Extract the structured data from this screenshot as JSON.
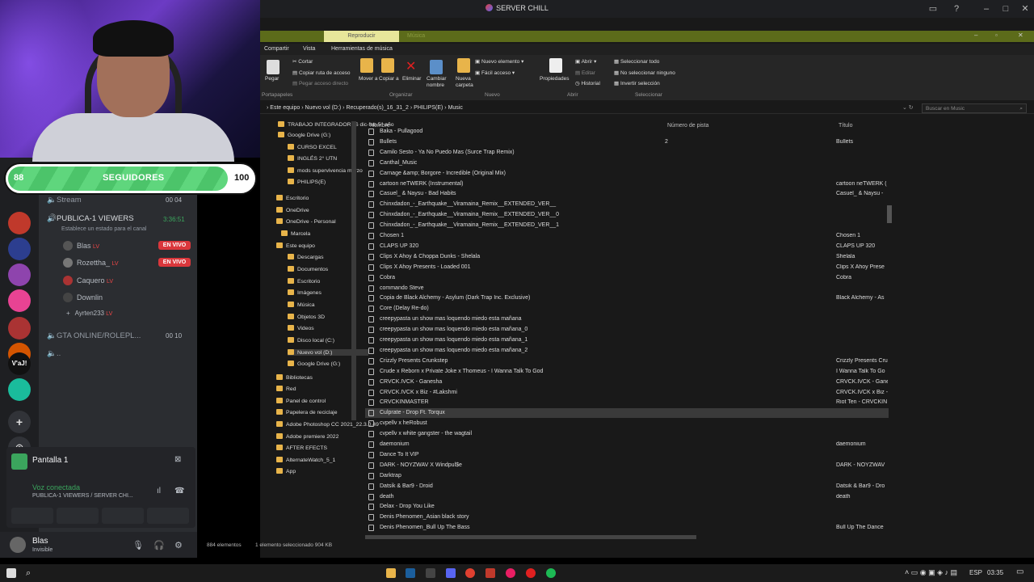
{
  "discord": {
    "window_title": "SERVER CHILL",
    "channels": [
      {
        "name": "Stream",
        "badge1": "00",
        "badge2": "04"
      },
      {
        "name": "PUBLICA-1 VIEWERS",
        "timer": "3:36:51",
        "desc": "Establece un estado para el canal"
      }
    ],
    "voice_users": [
      {
        "name": "Blas",
        "live": "EN VIVO"
      },
      {
        "name": "Rozettha_",
        "live": "EN VIVO"
      },
      {
        "name": "Caquero",
        "live": ""
      },
      {
        "name": "Downlin",
        "live": ""
      },
      {
        "name": "Ayrten233",
        "live": ""
      }
    ],
    "channel2": {
      "name": "GTA ONLINE/ROLEPL...",
      "badge1": "00",
      "badge2": "10"
    },
    "channel3": {
      "name": ".."
    },
    "lv_badge": "LV",
    "screen_share": {
      "label": "Pantalla 1"
    },
    "voice_connected": {
      "title": "Voz conectada",
      "sub": "PUBLICA-1 VIEWERS / SERVER CHI..."
    },
    "user": {
      "name": "Blas",
      "status": "Invisible"
    },
    "guild_labels": [
      "V'aJ!"
    ]
  },
  "overlay": {
    "followers_current": "88",
    "followers_label": "SEGUIDORES",
    "followers_goal": "100",
    "fill_fraction": 0.88
  },
  "explorer": {
    "ribbon_tabs": {
      "active": "Reproducir",
      "other": "Música"
    },
    "menus": [
      "Compartir",
      "Vista",
      "Herramientas de música"
    ],
    "ribbon": {
      "pegar": "Pegar",
      "cortar": "Cortar",
      "copiar_ruta": "Copiar ruta de acceso",
      "pegar_acceso": "Pegar acceso directo",
      "mover": "Mover a",
      "copiar": "Copiar a",
      "eliminar": "Eliminar",
      "cambiar": "Cambiar nombre",
      "nueva_carpeta": "Nueva carpeta",
      "nuevo_elemento": "Nuevo elemento",
      "facil_acceso": "Fácil acceso",
      "propiedades": "Propiedades",
      "abrir": "Abrir",
      "editar": "Editar",
      "historial": "Historial",
      "sel_todo": "Seleccionar todo",
      "no_sel": "No seleccionar ninguno",
      "invertir": "Invertir selección",
      "groups": [
        "Portapapeles",
        "Organizar",
        "Nuevo",
        "Abrir",
        "Seleccionar"
      ]
    },
    "breadcrumb": [
      "Este equipo",
      "Nuevo vol (D:)",
      "Recuperado(s)_16_31_2",
      "PHILIPS(E)",
      "Music"
    ],
    "search_placeholder": "Buscar en Music",
    "tree": [
      "TRABAJO INTEGRADORES dic-feb 5° año",
      "Google Drive (G:)",
      "CURSO EXCEL",
      "INGLÉS 2° UTN",
      "mods supervivencia marzo",
      "PHILIPS(E)",
      "Escritorio",
      "OneDrive",
      "OneDrive - Personal",
      "Marcela",
      "Este equipo",
      "Descargas",
      "Documentos",
      "Escritorio",
      "Imágenes",
      "Música",
      "Objetos 3D",
      "Videos",
      "Disco local (C:)",
      "Nuevo vol (D:)",
      "Google Drive (G:)",
      "Bibliotecas",
      "Red",
      "Panel de control",
      "Papelera de reciclaje",
      "Adobe Photoshop CC 2021_22.3.0.49",
      "Adobe premiere 2022",
      "AFTER EFECTS",
      "AlternateWatch_5_1",
      "App"
    ],
    "columns": {
      "name": "Nombre",
      "track": "Número de pista",
      "title": "Título"
    },
    "files": [
      {
        "name": "Baka - Pullagood",
        "track": "",
        "title": ""
      },
      {
        "name": "Bullets",
        "track": "2",
        "title": "Bullets"
      },
      {
        "name": "Camilo Sesto - Ya No Puedo Mas (Surce Trap Remix)",
        "track": "",
        "title": ""
      },
      {
        "name": "Canthal_Music",
        "track": "",
        "title": ""
      },
      {
        "name": "Carnage &amp; Borgore - Incredible (Original Mix)",
        "track": "",
        "title": ""
      },
      {
        "name": "cartoon neTWERK (Instrumental)",
        "track": "",
        "title": "cartoon neTWERK ("
      },
      {
        "name": "Casuel_ & Naysu - Bad Habits",
        "track": "",
        "title": "Casuel_ & Naysu -"
      },
      {
        "name": "Chinxdadon_-_Earthquake__Viramaina_Remix__EXTENDED_VER__",
        "track": "",
        "title": ""
      },
      {
        "name": "Chinxdadon_-_Earthquake__Viramaina_Remix__EXTENDED_VER__0",
        "track": "",
        "title": ""
      },
      {
        "name": "Chinxdadon_-_Earthquake__Viramaina_Remix__EXTENDED_VER__1",
        "track": "",
        "title": ""
      },
      {
        "name": "Chosen 1",
        "track": "",
        "title": "Chosen 1"
      },
      {
        "name": "CLAPS UP 320",
        "track": "",
        "title": "CLAPS UP 320"
      },
      {
        "name": "Clips X Ahoy & Choppa Dunks - Shelala",
        "track": "",
        "title": "Shelala"
      },
      {
        "name": "Clips X Ahoy Presents - Loaded 001",
        "track": "",
        "title": "Clips X Ahoy Prese"
      },
      {
        "name": "Cobra",
        "track": "",
        "title": "Cobra"
      },
      {
        "name": "commando Steve",
        "track": "",
        "title": ""
      },
      {
        "name": "Copia de Black Alchemy - Asylum (Dark Trap Inc. Exclusive)",
        "track": "",
        "title": "Black Alchemy - As"
      },
      {
        "name": "Core (Delay Re-do)",
        "track": "",
        "title": ""
      },
      {
        "name": "creepypasta un show mas loquendo miedo esta mañana",
        "track": "",
        "title": ""
      },
      {
        "name": "creepypasta un show mas loquendo miedo esta mañana_0",
        "track": "",
        "title": ""
      },
      {
        "name": "creepypasta un show mas loquendo miedo esta mañana_1",
        "track": "",
        "title": ""
      },
      {
        "name": "creepypasta un show mas loquendo miedo esta mañana_2",
        "track": "",
        "title": ""
      },
      {
        "name": "Crizzly Presents Crunkstep",
        "track": "",
        "title": "Crizzly Presents Cru"
      },
      {
        "name": "Crude x Reborn x Private Joke x Thomeus - I Wanna Talk To God",
        "track": "",
        "title": "I Wanna Talk To Go"
      },
      {
        "name": "CRVCK.IVCK - Ganesha",
        "track": "",
        "title": "CRVCK.IVCK - Gane"
      },
      {
        "name": "CRVCK.IVCK x Biz - #Lakshmi",
        "track": "",
        "title": "CRVCK.IVCK x Biz -"
      },
      {
        "name": "CRVCKINMASTER",
        "track": "",
        "title": "Riot Ten - CRVCKIN"
      },
      {
        "name": "Culprate - Drop Ft. Torqux",
        "track": "",
        "title": ""
      },
      {
        "name": "cvpellv x heRobust",
        "track": "",
        "title": ""
      },
      {
        "name": "cvpellv x white gangster - the wagtail",
        "track": "",
        "title": ""
      },
      {
        "name": "daemonium",
        "track": "",
        "title": "daemonium"
      },
      {
        "name": "Dance To It VIP",
        "track": "",
        "title": ""
      },
      {
        "name": "DARK - NOYZWAV X Windpul$e",
        "track": "",
        "title": "DARK - NOYZWAV"
      },
      {
        "name": "Darktrap",
        "track": "",
        "title": ""
      },
      {
        "name": "Datsik & Bar9 - Droid",
        "track": "",
        "title": "Datsik & Bar9 - Dro"
      },
      {
        "name": "death",
        "track": "",
        "title": "death"
      },
      {
        "name": "Delax - Drop You Like",
        "track": "",
        "title": ""
      },
      {
        "name": "Denis Phenomen_Asian black story",
        "track": "",
        "title": ""
      },
      {
        "name": "Denis Phenomen_Bull Up The Bass",
        "track": "",
        "title": "Bull Up The Dance"
      }
    ],
    "selected_index": 27,
    "status": {
      "count": "884 elementos",
      "selection": "1 elemento seleccionado  904 KB"
    }
  },
  "taskbar": {
    "lang": "ESP",
    "time": "03:35"
  }
}
